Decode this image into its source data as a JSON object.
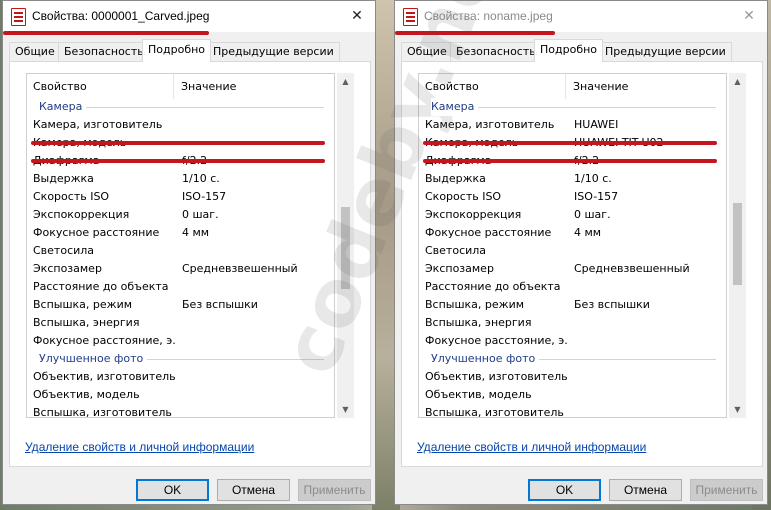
{
  "background": {
    "description_color": "#7d8a7a"
  },
  "accent_red": "#c4161c",
  "link_color": "#0645ad",
  "watermark": "codeby.net",
  "dialogs": [
    {
      "title": "Свойства: 0000001_Carved.jpeg",
      "tabs": [
        "Общие",
        "Безопасность",
        "Подробно",
        "Предыдущие версии"
      ],
      "active_tab": "Подробно",
      "header": {
        "property": "Свойство",
        "value": "Значение"
      },
      "groups": {
        "camera": "Камера",
        "enhanced": "Улучшенное фото"
      },
      "rows": [
        {
          "p": "Камера, изготовитель",
          "v": ""
        },
        {
          "p": "Камера, модель",
          "v": ""
        },
        {
          "p": "Диафрагма",
          "v": "f/2.2"
        },
        {
          "p": "Выдержка",
          "v": "1/10 с."
        },
        {
          "p": "Скорость ISO",
          "v": "ISO-157"
        },
        {
          "p": "Экспокоррекция",
          "v": "0 шаг."
        },
        {
          "p": "Фокусное расстояние",
          "v": "4 мм"
        },
        {
          "p": "Светосила",
          "v": ""
        },
        {
          "p": "Экспозамер",
          "v": "Средневзвешенный"
        },
        {
          "p": "Расстояние до объекта",
          "v": ""
        },
        {
          "p": "Вспышка, режим",
          "v": "Без вспышки"
        },
        {
          "p": "Вспышка, энергия",
          "v": ""
        },
        {
          "p": "Фокусное расстояние, э...",
          "v": ""
        }
      ],
      "enhanced_rows": [
        {
          "p": "Объектив, изготовитель",
          "v": ""
        },
        {
          "p": "Объектив, модель",
          "v": ""
        },
        {
          "p": "Вспышка, изготовитель",
          "v": ""
        }
      ],
      "remove_link": "Удаление свойств и личной информации",
      "buttons": {
        "ok": "OK",
        "cancel": "Отмена",
        "apply": "Применить"
      }
    },
    {
      "title": "Свойства: noname.jpeg",
      "tabs": [
        "Общие",
        "Безопасность",
        "Подробно",
        "Предыдущие версии"
      ],
      "active_tab": "Подробно",
      "header": {
        "property": "Свойство",
        "value": "Значение"
      },
      "groups": {
        "camera": "Камера",
        "enhanced": "Улучшенное фото"
      },
      "rows": [
        {
          "p": "Камера, изготовитель",
          "v": "HUAWEI"
        },
        {
          "p": "Камера, модель",
          "v": "HUAWEI TIT-U02"
        },
        {
          "p": "Диафрагма",
          "v": "f/2.2"
        },
        {
          "p": "Выдержка",
          "v": "1/10 с."
        },
        {
          "p": "Скорость ISO",
          "v": "ISO-157"
        },
        {
          "p": "Экспокоррекция",
          "v": "0 шаг."
        },
        {
          "p": "Фокусное расстояние",
          "v": "4 мм"
        },
        {
          "p": "Светосила",
          "v": ""
        },
        {
          "p": "Экспозамер",
          "v": "Средневзвешенный"
        },
        {
          "p": "Расстояние до объекта",
          "v": ""
        },
        {
          "p": "Вспышка, режим",
          "v": "Без вспышки"
        },
        {
          "p": "Вспышка, энергия",
          "v": ""
        },
        {
          "p": "Фокусное расстояние, э...",
          "v": ""
        }
      ],
      "enhanced_rows": [
        {
          "p": "Объектив, изготовитель",
          "v": ""
        },
        {
          "p": "Объектив, модель",
          "v": ""
        },
        {
          "p": "Вспышка, изготовитель",
          "v": ""
        }
      ],
      "remove_link": "Удаление свойств и личной информации",
      "buttons": {
        "ok": "OK",
        "cancel": "Отмена",
        "apply": "Применить"
      }
    }
  ]
}
